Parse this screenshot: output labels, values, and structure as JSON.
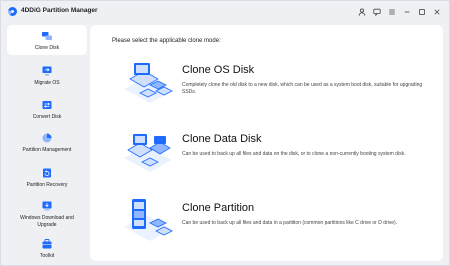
{
  "app": {
    "title": "4DDiG Partition Manager"
  },
  "sidebar": {
    "items": [
      {
        "label": "Clone Disk",
        "icon": "clone-disk-icon",
        "active": true
      },
      {
        "label": "Migrate OS",
        "icon": "migrate-os-icon"
      },
      {
        "label": "Convert Disk",
        "icon": "convert-disk-icon"
      },
      {
        "label": "Partition Management",
        "icon": "partition-management-icon"
      },
      {
        "label": "Partition Recovery",
        "icon": "partition-recovery-icon"
      },
      {
        "label": "Windows Download and Upgrade",
        "icon": "windows-download-icon"
      },
      {
        "label": "Toolkit",
        "icon": "toolkit-icon"
      }
    ]
  },
  "main": {
    "prompt": "Please select the applicable clone mode:",
    "options": [
      {
        "title": "Clone OS Disk",
        "description": "Completely clone the old disk to a new disk, which can be used as a system boot disk, suitable for upgrading SSDs."
      },
      {
        "title": "Clone Data Disk",
        "description": "Can be used to back up all files and data on the disk, or to clone a non-currently booting system disk."
      },
      {
        "title": "Clone Partition",
        "description": "Can be used to back up all files and data in a partition (common partitions like C drive or D drive)."
      }
    ]
  },
  "colors": {
    "accent": "#1f6bff",
    "illus_light": "#cfe0ff",
    "illus_mid": "#8fb6ff"
  }
}
